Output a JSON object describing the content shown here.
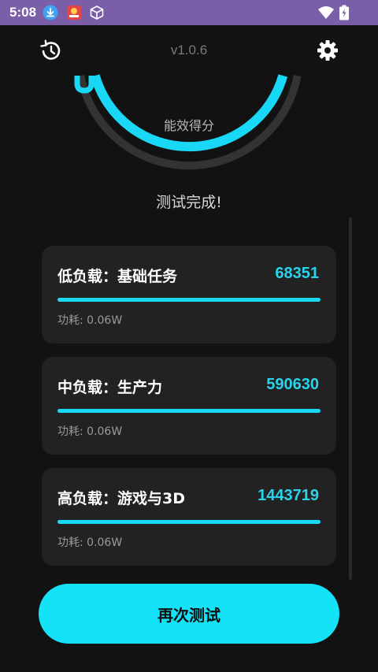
{
  "status_bar": {
    "time": "5:08",
    "background": "#7b5ea8",
    "left_icons": [
      "download-icon",
      "notification-app-icon",
      "cube-icon"
    ],
    "right_icons": [
      "wifi-icon",
      "battery-icon"
    ]
  },
  "header": {
    "version": "v1.0.6",
    "history_icon": "history-icon",
    "settings_icon": "gear-icon"
  },
  "gauge": {
    "label": "能效得分",
    "accent": "#18d8f5"
  },
  "status_text": "测试完成!",
  "results": [
    {
      "title": "低负载：基础任务",
      "score": "68351",
      "progress": 1.0,
      "power": "功耗: 0.06W"
    },
    {
      "title": "中负载：生产力",
      "score": "590630",
      "progress": 1.0,
      "power": "功耗: 0.06W"
    },
    {
      "title": "高负载：游戏与3D",
      "score": "1443719",
      "progress": 1.0,
      "power": "功耗: 0.06W"
    }
  ],
  "retest_button": {
    "label": "再次测试",
    "color": "#14e2f7"
  }
}
